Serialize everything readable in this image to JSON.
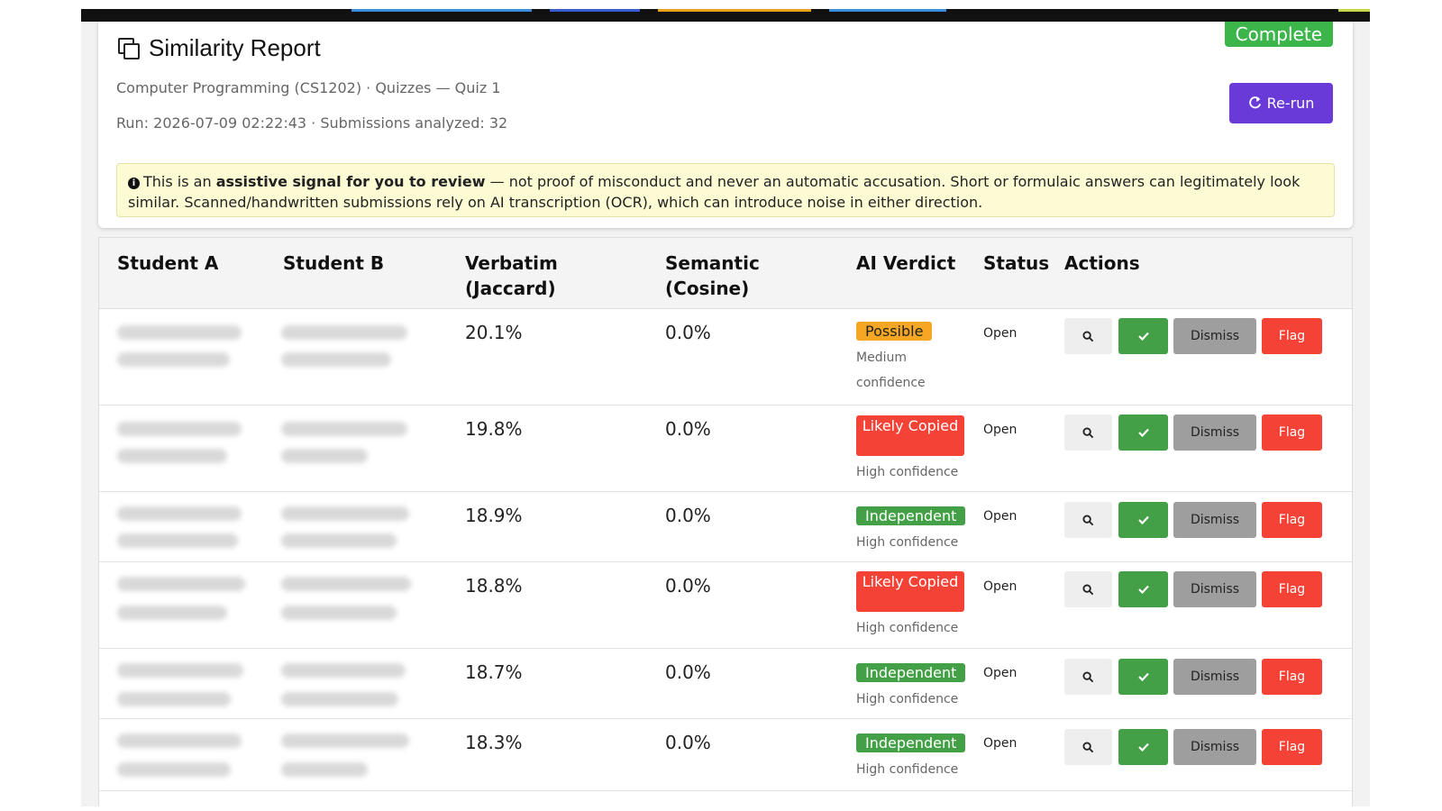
{
  "header": {
    "title": "Similarity Report",
    "course_line": "Computer Programming (CS1202) · Quizzes — Quiz 1",
    "run_line": "Run: 2026-07-09 02:22:43 · Submissions analyzed: 32",
    "status_badge": "Complete",
    "rerun_label": "Re-run"
  },
  "notice": {
    "prefix": "This is an ",
    "bold": "assistive signal for you to review",
    "suffix": " — not proof of misconduct and never an automatic accusation. Short or formulaic answers can legitimately look similar. Scanned/handwritten submissions rely on AI transcription (OCR), which can introduce noise in either direction."
  },
  "table": {
    "headers": {
      "student_a": "Student A",
      "student_b": "Student B",
      "verbatim": "Verbatim (Jaccard)",
      "semantic": "Semantic (Cosine)",
      "verdict": "AI Verdict",
      "status": "Status",
      "actions": "Actions"
    },
    "buttons": {
      "dismiss": "Dismiss",
      "flag": "Flag"
    },
    "rows": [
      {
        "verbatim": "20.1%",
        "semantic": "0.0%",
        "verdict": "Possible",
        "confidence": "Medium confidence",
        "status": "Open"
      },
      {
        "verbatim": "19.8%",
        "semantic": "0.0%",
        "verdict": "Likely Copied",
        "confidence": "High confidence",
        "status": "Open"
      },
      {
        "verbatim": "18.9%",
        "semantic": "0.0%",
        "verdict": "Independent",
        "confidence": "High confidence",
        "status": "Open"
      },
      {
        "verbatim": "18.8%",
        "semantic": "0.0%",
        "verdict": "Likely Copied",
        "confidence": "High confidence",
        "status": "Open"
      },
      {
        "verbatim": "18.7%",
        "semantic": "0.0%",
        "verdict": "Independent",
        "confidence": "High confidence",
        "status": "Open"
      },
      {
        "verbatim": "18.3%",
        "semantic": "0.0%",
        "verdict": "Independent",
        "confidence": "High confidence",
        "status": "Open"
      }
    ]
  },
  "colors": {
    "accent": "#6a3ad8",
    "success": "#43a047",
    "danger": "#f44336",
    "warning": "#f5a623",
    "neutral": "#9e9e9e"
  },
  "icons": {
    "title": "copy-icon",
    "rerun": "refresh-icon",
    "notice": "info-icon",
    "view": "search-icon",
    "confirm": "check-icon"
  }
}
